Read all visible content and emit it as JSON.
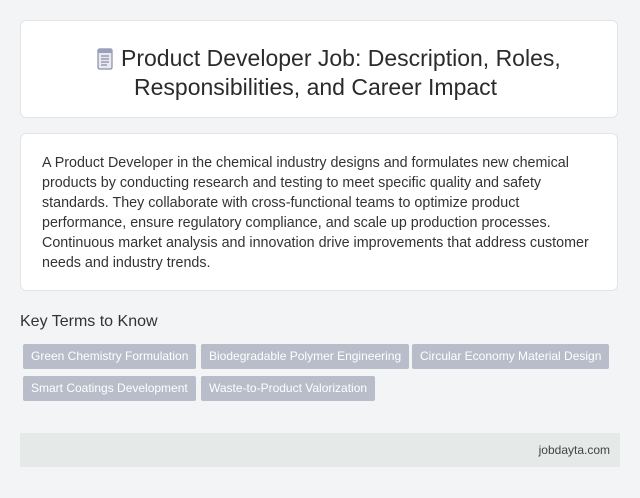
{
  "header": {
    "icon": "document-icon",
    "title_line1": "Product Developer Job: Description, Roles,",
    "title_line2": "Responsibilities, and Career Impact"
  },
  "description": {
    "text": "A Product Developer in the chemical industry designs and formulates new chemical products by conducting research and testing to meet specific quality and safety standards. They collaborate with cross-functional teams to optimize product performance, ensure regulatory compliance, and scale up production processes. Continuous market analysis and innovation drive improvements that address customer needs and industry trends."
  },
  "key_terms": {
    "heading": "Key Terms to Know",
    "tags": [
      "Green Chemistry Formulation",
      "Biodegradable Polymer Engineering",
      "Circular Economy Material Design",
      "Smart Coatings Development",
      "Waste-to-Product Valorization"
    ]
  },
  "footer": {
    "site": "jobdayta.com"
  },
  "colors": {
    "tag_bg": "#b8bdc9",
    "footer_bg": "#e5e9e7",
    "page_bg": "#f3f4f6"
  }
}
